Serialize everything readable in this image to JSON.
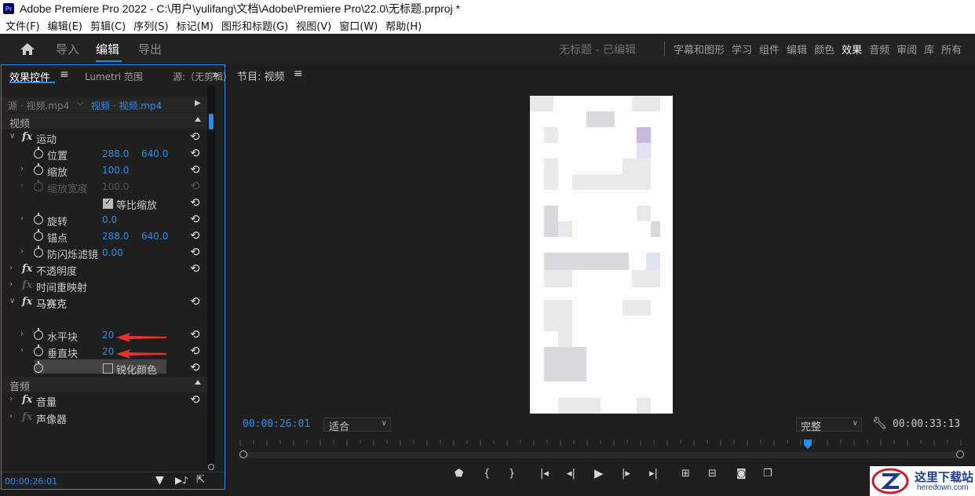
{
  "window": {
    "title": "Adobe Premiere Pro 2022 - C:\\用户\\yulifang\\文档\\Adobe\\Premiere Pro\\22.0\\无标题.prproj *",
    "logo_text": "Pr"
  },
  "menu": [
    "文件(F)",
    "编辑(E)",
    "剪辑(C)",
    "序列(S)",
    "标记(M)",
    "图形和标题(G)",
    "视图(V)",
    "窗口(W)",
    "帮助(H)"
  ],
  "workspace": {
    "nav_tabs": [
      "导入",
      "编辑",
      "导出"
    ],
    "project_title": "无标题 - 已编辑",
    "workspaces": [
      "字幕和图形",
      "学习",
      "组件",
      "编辑",
      "颜色",
      "效果",
      "音频",
      "审阅",
      "库",
      "所有"
    ],
    "active_workspace": "效果"
  },
  "effect_panel": {
    "tab_effect_controls": "效果控件",
    "tab_lumetri": "Lumetri 范围",
    "tab_source": "源:（无剪辑）",
    "source_clip": "源 · 视频.mp4",
    "sequence_clip": "视频 · 视频.mp4",
    "video_section": "视频",
    "audio_section": "音频",
    "motion": "运动",
    "position_label": "位置",
    "position_x": "288.0",
    "position_y": "640.0",
    "scale_label": "缩放",
    "scale_value": "100.0",
    "scale_width_label": "缩放宽度",
    "scale_width_value": "100.0",
    "uniform_scale_label": "等比缩放",
    "rotation_label": "旋转",
    "rotation_value": "0.0",
    "anchor_label": "锚点",
    "anchor_x": "288.0",
    "anchor_y": "640.0",
    "flicker_label": "防闪烁滤镜",
    "flicker_value": "0.00",
    "opacity": "不透明度",
    "time_remap": "时间重映射",
    "mosaic": "马赛克",
    "h_blocks_label": "水平块",
    "h_blocks_value": "20",
    "v_blocks_label": "垂直块",
    "v_blocks_value": "20",
    "sharpen_colors_label": "锐化颜色",
    "volume": "音量",
    "channel_volume": "声像器",
    "fx": "fx",
    "timecode": "00:00:26:01"
  },
  "program_monitor": {
    "title": "节目: 视频",
    "timecode_current": "00:00:26:01",
    "fit_value": "适合",
    "resolution_value": "完整",
    "timecode_duration": "00:00:33:13",
    "playhead_fraction": 0.78
  },
  "watermark": {
    "title": "这里下载站",
    "url": "heredown.com"
  },
  "colors": {
    "accent": "#2d8ceb",
    "background": "#1d1d1d",
    "annotation_arrow": "#e8322b"
  }
}
